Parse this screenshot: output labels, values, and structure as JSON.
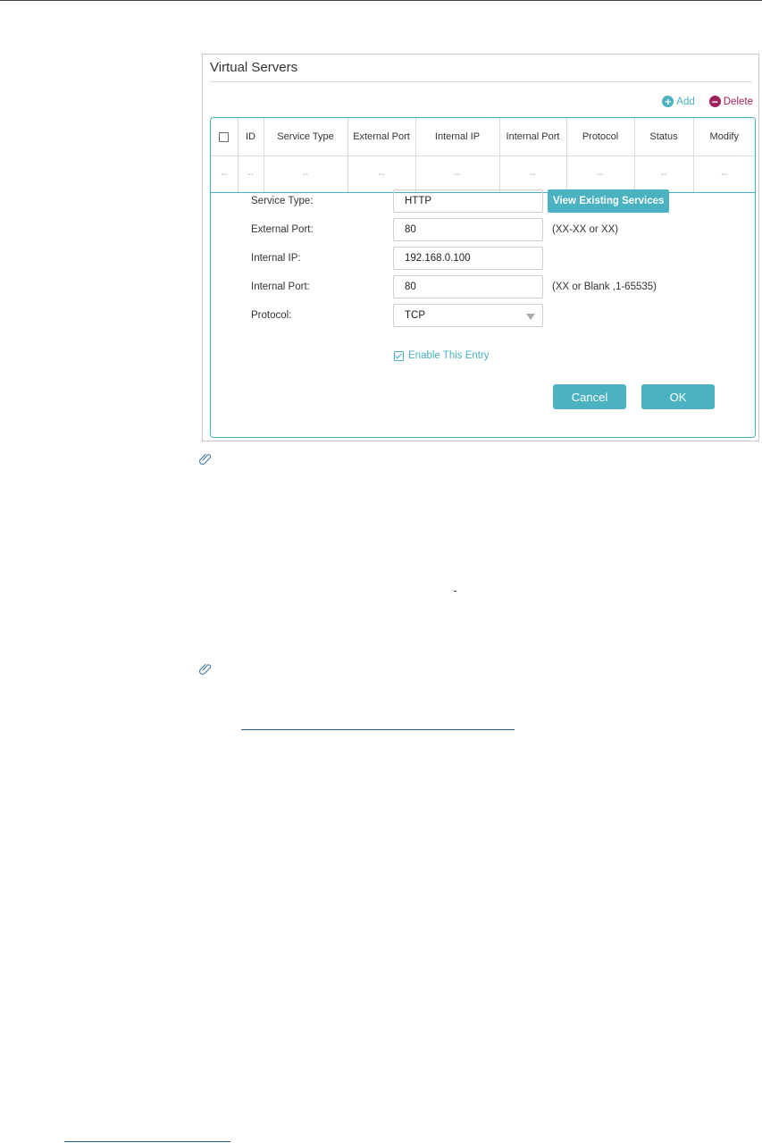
{
  "panel": {
    "title": "Virtual Servers"
  },
  "toolbar": {
    "add_label": "Add",
    "delete_label": "Delete"
  },
  "table": {
    "columns": [
      "ID",
      "Service Type",
      "External Port",
      "Internal IP",
      "Internal Port",
      "Protocol",
      "Status",
      "Modify"
    ],
    "empty_row": [
      "--",
      "--",
      "--",
      "--",
      "--",
      "--",
      "--",
      "--",
      "--"
    ]
  },
  "form": {
    "service_type_label": "Service Type:",
    "service_type_value": "HTTP",
    "view_services_label": "View Existing Services",
    "external_port_label": "External Port:",
    "external_port_value": "80",
    "external_port_hint": "(XX-XX or XX)",
    "internal_ip_label": "Internal IP:",
    "internal_ip_value": "192.168.0.100",
    "internal_port_label": "Internal Port:",
    "internal_port_value": "80",
    "internal_port_hint": "(XX or Blank ,1-65535)",
    "protocol_label": "Protocol:",
    "protocol_value": "TCP",
    "enable_label": "Enable This Entry",
    "cancel_label": "Cancel",
    "ok_label": "OK"
  },
  "colors": {
    "accent": "#4ab2c0",
    "delete": "#a0225c",
    "link": "#2b5c86"
  }
}
